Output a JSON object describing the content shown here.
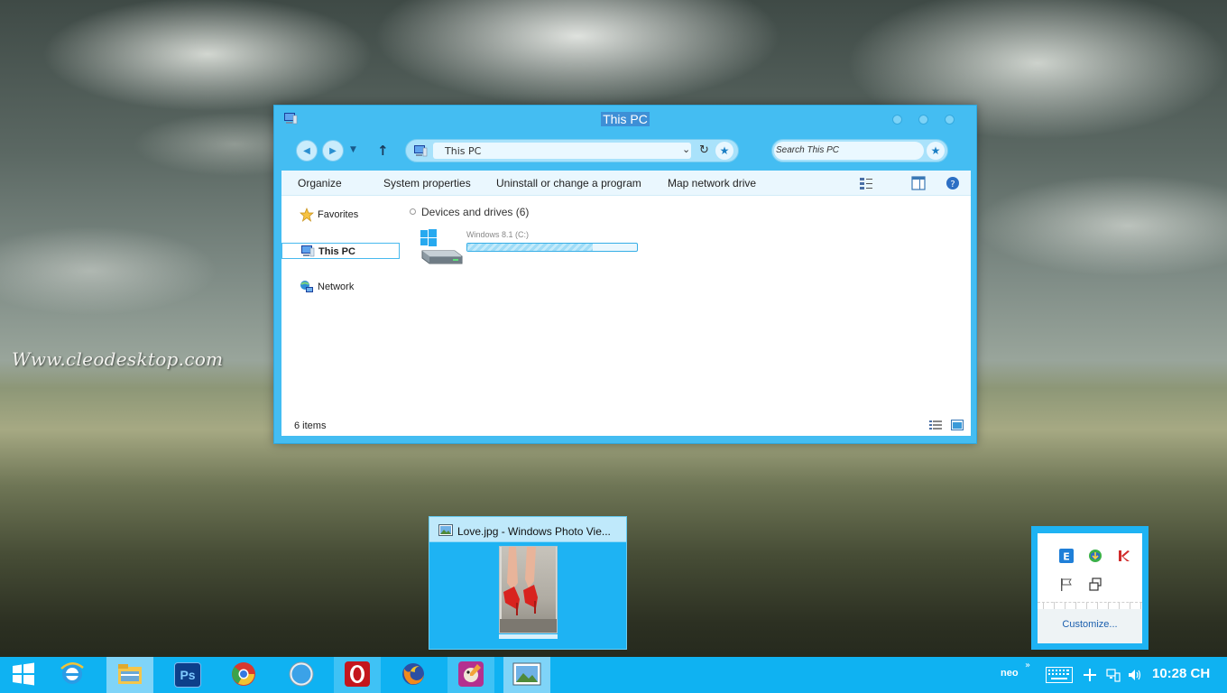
{
  "desktop": {
    "watermark": "Www.cleodesktop.com"
  },
  "explorer": {
    "title": "This PC",
    "address": "This PC",
    "search_placeholder": "Search This PC",
    "commands": [
      "Organize",
      "System properties",
      "Uninstall or change a program",
      "Map network drive"
    ],
    "nav": {
      "favorites": "Favorites",
      "this_pc": "This PC",
      "network": "Network"
    },
    "group_header": "Devices and drives (6)",
    "drive": {
      "name": "Windows 8.1 (C:)",
      "used_fraction": 0.74
    },
    "status": "6 items",
    "accent": "#44bdf2"
  },
  "thumbnail": {
    "title": "Love.jpg - Windows Photo Vie..."
  },
  "tray_popup": {
    "customize": "Customize..."
  },
  "taskbar": {
    "apps": [
      "start-icon",
      "internet-explorer-icon",
      "file-explorer-icon",
      "photoshop-icon",
      "chrome-icon",
      "safari-icon",
      "opera-icon",
      "firefox-icon",
      "gimp-icon",
      "photo-viewer-icon"
    ],
    "photoshop_label": "Ps",
    "user": "neo",
    "chevron": "»",
    "clock": "10:28 CH",
    "color": "#0fb2f2"
  }
}
